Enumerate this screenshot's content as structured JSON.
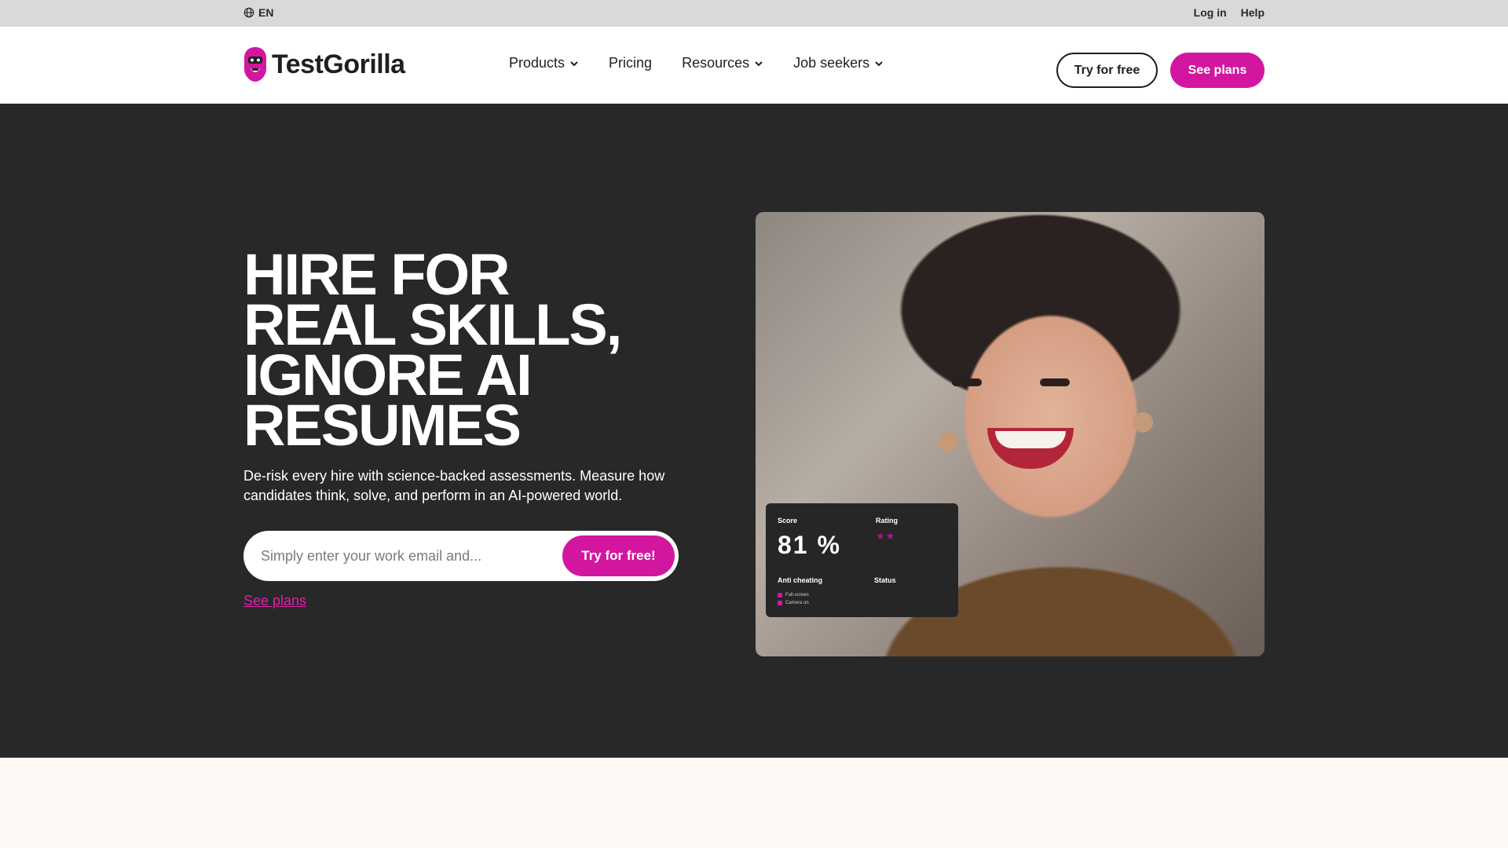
{
  "topbar": {
    "language": "EN",
    "login": "Log in",
    "help": "Help"
  },
  "brand": {
    "name": "TestGorilla",
    "accent": "#d3169f",
    "logo_icon": "gorilla-shield-logo"
  },
  "nav": {
    "items": [
      {
        "label": "Products",
        "dropdown": true
      },
      {
        "label": "Pricing",
        "dropdown": false
      },
      {
        "label": "Resources",
        "dropdown": true
      },
      {
        "label": "Job seekers",
        "dropdown": true
      }
    ],
    "try_free": "Try for free",
    "see_plans": "See plans"
  },
  "hero": {
    "headline_lines": [
      "HIRE FOR",
      "REAL SKILLS,",
      "IGNORE AI",
      "RESUMES"
    ],
    "subtext": "De-risk every hire with science-backed assessments. Measure how candidates think, solve, and perform in an AI-powered world.",
    "email_placeholder": "Simply enter your work email and...",
    "cta": "Try for free!",
    "see_plans_link": "See plans"
  },
  "score_card": {
    "score_label": "Score",
    "score_value": "81 %",
    "rating_label": "Rating",
    "rating_stars": "★★",
    "anti_cheating_label": "Anti cheating",
    "status_label": "Status",
    "anti_cheating_items": [
      "Full-screen",
      "Camera on"
    ]
  },
  "colors": {
    "hero_bg": "#282828",
    "topbar_bg": "#d9d9d9",
    "page_bg": "#fdf8f3"
  }
}
